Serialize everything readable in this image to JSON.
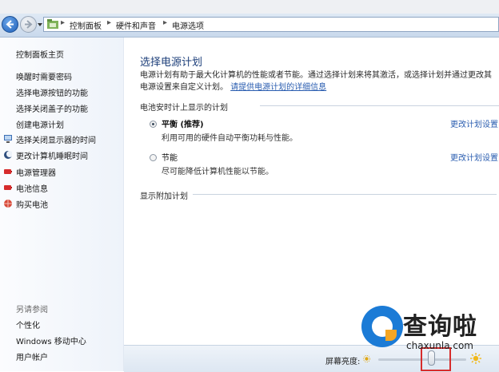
{
  "address": {
    "crumbs": [
      "控制面板",
      "硬件和声音",
      "电源选项"
    ],
    "separator": "▸"
  },
  "sidebar": {
    "items": [
      {
        "label": "控制面板主页"
      },
      {
        "label": "唤醒时需要密码"
      },
      {
        "label": "选择电源按钮的功能"
      },
      {
        "label": "选择关闭盖子的功能"
      },
      {
        "label": "创建电源计划"
      },
      {
        "label": "选择关闭显示器的时间",
        "icon": "display-icon"
      },
      {
        "label": "更改计算机睡眠时间",
        "icon": "moon-icon"
      }
    ],
    "links": [
      {
        "label": "电源管理器",
        "icon": "battery-red-icon"
      },
      {
        "label": "电池信息",
        "icon": "battery-red-icon"
      },
      {
        "label": "购买电池",
        "icon": "globe-icon"
      }
    ],
    "see_also_title": "另请参阅",
    "see_also": [
      "个性化",
      "Windows 移动中心",
      "用户帐户"
    ]
  },
  "main": {
    "title": "选择电源计划",
    "description": "电源计划有助于最大化计算机的性能或者节能。通过选择计划来将其激活，或选择计划并通过更改其电源设置来自定义计划。",
    "description_link": "请提供电源计划的详细信息",
    "plans_group": "电池安时计上显示的计划",
    "plans": [
      {
        "name": "平衡 (推荐)",
        "desc": "利用可用的硬件自动平衡功耗与性能。",
        "selected": true,
        "change": "更改计划设置"
      },
      {
        "name": "节能",
        "desc": "尽可能降低计算机性能以节能。",
        "selected": false,
        "change": "更改计划设置"
      }
    ],
    "more_plans": "显示附加计划"
  },
  "bottom": {
    "brightness_label": "屏幕亮度:",
    "brightness_level": 0.6
  },
  "watermark": {
    "text": "查询啦",
    "url": "chaxunla.com",
    "colors": {
      "blue": "#1b7bd6",
      "orange": "#f5a623"
    }
  },
  "colors": {
    "link": "#2a5db0",
    "title": "#1d3f7a",
    "highlight": "#d62c2c"
  }
}
